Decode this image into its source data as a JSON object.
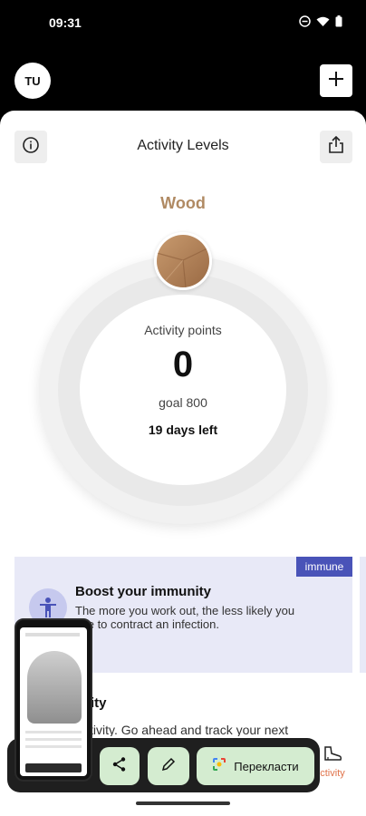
{
  "status_bar": {
    "time": "09:31",
    "icons": [
      "do-not-disturb-icon",
      "wifi-icon",
      "battery-icon"
    ]
  },
  "top_bar": {
    "avatar_initials": "TU",
    "add_icon": "plus-icon"
  },
  "header": {
    "title": "Activity Levels",
    "info_icon": "info-icon",
    "share_icon": "share-icon"
  },
  "level": {
    "name": "Wood",
    "color": "#b08a63"
  },
  "progress": {
    "label": "Activity points",
    "points": "0",
    "goal_text": "goal 800",
    "days_left": "19 days left"
  },
  "card": {
    "tag": "immune",
    "title": "Boost your immunity",
    "body_line1": "The more you work out, the less likely you",
    "body_line2": "l be to contract an infection.",
    "accent_color": "#4953b8"
  },
  "section": {
    "title_fragment": "ity",
    "body_fragment": "ctivity. Go ahead and track your next"
  },
  "bottom_nav": {
    "active_label": "ctivity",
    "active_color": "#e0734a"
  },
  "floating_toolbar": {
    "translate_label": "Перекласти"
  }
}
